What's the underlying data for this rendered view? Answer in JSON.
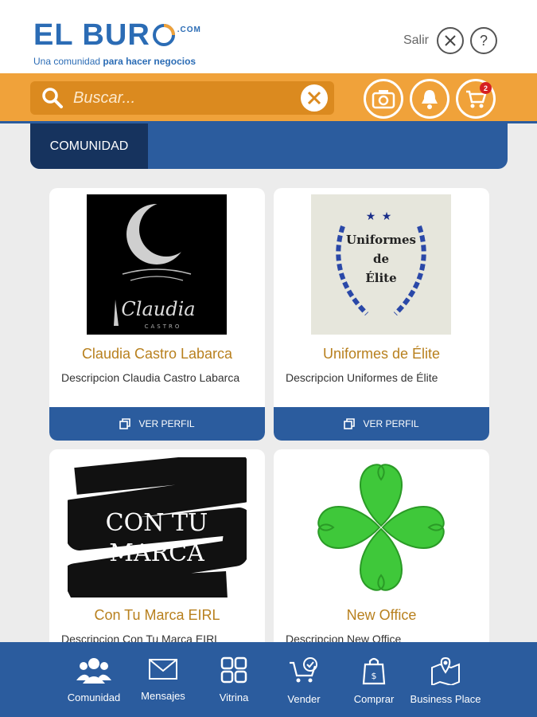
{
  "header": {
    "logo_text": "EL BUR",
    "logo_com": ".COM",
    "tagline_pre": "Una comunidad ",
    "tagline_bold": "para hacer negocios",
    "salir_label": "Salir",
    "help_label": "?"
  },
  "search": {
    "placeholder": "Buscar...",
    "cart_count": "2"
  },
  "tabs": {
    "active_label": "COMUNIDAD"
  },
  "cards": [
    {
      "title": "Claudia Castro Labarca",
      "description": "Descripcion Claudia Castro Labarca",
      "button_label": "VER PERFIL",
      "image_text": "Claudia",
      "image_subtext": "CASTRO"
    },
    {
      "title": "Uniformes de Élite",
      "description": "Descripcion Uniformes de Élite",
      "button_label": "VER PERFIL",
      "image_line1": "Uniformes",
      "image_line2": "de",
      "image_line3": "Élite"
    },
    {
      "title": "Con Tu Marca EIRL",
      "description": "Descripcion Con Tu Marca EIRL",
      "image_line1": "CON TU",
      "image_line2": "MARCA"
    },
    {
      "title": "New Office",
      "description": "Descripcion New Office"
    }
  ],
  "bottom_nav": [
    {
      "label": "Comunidad",
      "icon": "people-icon"
    },
    {
      "label": "Mensajes",
      "icon": "envelope-icon"
    },
    {
      "label": "Vitrina",
      "icon": "grid-icon"
    },
    {
      "label": "Vender",
      "icon": "cart-check-icon"
    },
    {
      "label": "Comprar",
      "icon": "shopping-bag-icon"
    },
    {
      "label": "Business Place",
      "icon": "map-pin-icon"
    }
  ],
  "colors": {
    "brand_blue": "#2b5c9e",
    "dark_blue": "#16335e",
    "orange": "#f0a23a",
    "title_gold": "#b8801e"
  }
}
